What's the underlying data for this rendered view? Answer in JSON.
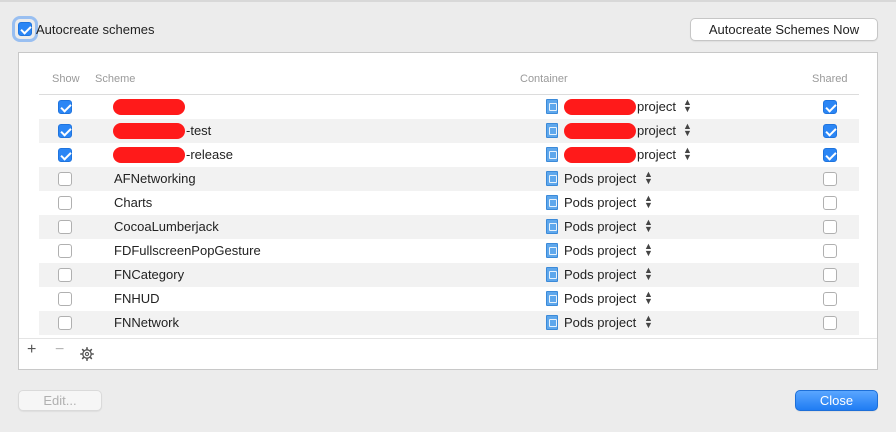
{
  "header": {
    "autocreate_label": "Autocreate schemes",
    "autocreate_checked": true,
    "autocreate_now_button": "Autocreate Schemes Now"
  },
  "table": {
    "columns": {
      "show": "Show",
      "scheme": "Scheme",
      "container": "Container",
      "shared": "Shared"
    },
    "rows": [
      {
        "show": true,
        "scheme": "",
        "container": "project",
        "shared": true,
        "redacted": true
      },
      {
        "show": true,
        "scheme": "-test",
        "container": "project",
        "shared": true,
        "redacted": true
      },
      {
        "show": true,
        "scheme": "-release",
        "container": "project",
        "shared": true,
        "redacted": true
      },
      {
        "show": false,
        "scheme": "AFNetworking",
        "container": "Pods project",
        "shared": false,
        "redacted": false
      },
      {
        "show": false,
        "scheme": "Charts",
        "container": "Pods project",
        "shared": false,
        "redacted": false
      },
      {
        "show": false,
        "scheme": "CocoaLumberjack",
        "container": "Pods project",
        "shared": false,
        "redacted": false
      },
      {
        "show": false,
        "scheme": "FDFullscreenPopGesture",
        "container": "Pods project",
        "shared": false,
        "redacted": false
      },
      {
        "show": false,
        "scheme": "FNCategory",
        "container": "Pods project",
        "shared": false,
        "redacted": false
      },
      {
        "show": false,
        "scheme": "FNHUD",
        "container": "Pods project",
        "shared": false,
        "redacted": false
      },
      {
        "show": false,
        "scheme": "FNNetwork",
        "container": "Pods project",
        "shared": false,
        "redacted": false
      }
    ]
  },
  "footer_controls": {
    "add": "+",
    "remove": "−"
  },
  "buttons": {
    "edit": "Edit...",
    "close": "Close"
  },
  "colors": {
    "accent": "#2b86f5",
    "redaction": "#ff1a1a"
  }
}
